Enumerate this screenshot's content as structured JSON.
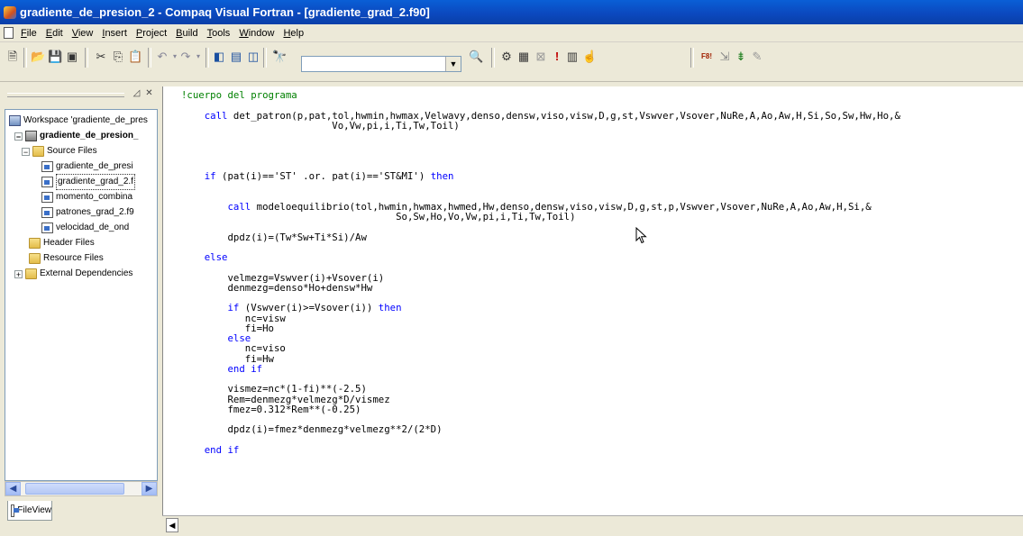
{
  "window": {
    "title": "gradiente_de_presion_2 - Compaq Visual Fortran - [gradiente_grad_2.f90]"
  },
  "menu": {
    "items": [
      {
        "u": "F",
        "rest": "ile"
      },
      {
        "u": "E",
        "rest": "dit"
      },
      {
        "u": "V",
        "rest": "iew"
      },
      {
        "u": "I",
        "rest": "nsert"
      },
      {
        "u": "P",
        "rest": "roject"
      },
      {
        "u": "B",
        "rest": "uild"
      },
      {
        "u": "T",
        "rest": "ools"
      },
      {
        "u": "W",
        "rest": "indow"
      },
      {
        "u": "H",
        "rest": "elp"
      }
    ]
  },
  "toolbar": {
    "find_value": "",
    "icons": [
      "new-file-icon",
      "open-folder-icon",
      "save-icon",
      "save-all-icon",
      "cut-icon",
      "copy-icon",
      "paste-icon",
      "undo-icon",
      "redo-icon",
      "workspace-icon",
      "output-icon",
      "windows-icon",
      "find-in-files-icon",
      "find-icon",
      "compile-icon",
      "build-icon",
      "stop-build-icon",
      "execute-icon",
      "breakpoint-icon",
      "go-icon",
      "f8-icon",
      "step-icon",
      "debug-icon",
      "pen-icon"
    ]
  },
  "workspace": {
    "tree": [
      {
        "label": "Workspace 'gradiente_de_pres",
        "icon": "workspace-icon",
        "expander": ""
      },
      {
        "label": "gradiente_de_presion_",
        "icon": "project-icon",
        "expander": "−",
        "bold": true
      },
      {
        "label": "Source Files",
        "icon": "folder-icon",
        "expander": "−"
      },
      {
        "label": "gradiente_de_presi",
        "icon": "file-icon",
        "expander": ""
      },
      {
        "label": "gradiente_grad_2.f",
        "icon": "file-icon",
        "expander": "",
        "selected": true
      },
      {
        "label": "momento_combina",
        "icon": "file-icon",
        "expander": ""
      },
      {
        "label": "patrones_grad_2.f9",
        "icon": "file-icon",
        "expander": ""
      },
      {
        "label": "velocidad_de_ond",
        "icon": "file-icon",
        "expander": ""
      },
      {
        "label": "Header Files",
        "icon": "folder-icon",
        "expander": ""
      },
      {
        "label": "Resource Files",
        "icon": "folder-icon",
        "expander": ""
      },
      {
        "label": "External Dependencies",
        "icon": "folder-icon",
        "expander": "+"
      }
    ],
    "tab_label": "FileView"
  },
  "editor": {
    "lines": [
      "!cuerpo del programa",
      "",
      "    call det_patron(p,pat,tol,hwmin,hwmax,Velwavy,denso,densw,viso,visw,D,g,st,Vswver,Vsover,NuRe,A,Ao,Aw,H,Si,So,Sw,Hw,Ho,&",
      "                          Vo,Vw,pi,i,Ti,Tw,Toil)",
      "",
      "",
      "",
      "",
      "    if (pat(i)=='ST' .or. pat(i)=='ST&MI') then",
      "",
      "",
      "        call modeloequilibrio(tol,hwmin,hwmax,hwmed,Hw,denso,densw,viso,visw,D,g,st,p,Vswver,Vsover,NuRe,A,Ao,Aw,H,Si,&",
      "                                     So,Sw,Ho,Vo,Vw,pi,i,Ti,Tw,Toil)",
      "",
      "        dpdz(i)=(Tw*Sw+Ti*Si)/Aw",
      "",
      "    else",
      "",
      "        velmezg=Vswver(i)+Vsover(i)",
      "        denmezg=denso*Ho+densw*Hw",
      "",
      "        if (Vswver(i)>=Vsover(i)) then",
      "           nc=visw",
      "           fi=Ho",
      "        else",
      "           nc=viso",
      "           fi=Hw",
      "        end if",
      "",
      "        vismez=nc*(1-fi)**(-2.5)",
      "        Rem=denmezg*velmezg*D/vismez",
      "        fmez=0.312*Rem**(-0.25)",
      "",
      "        dpdz(i)=fmez*denmezg*velmezg**2/(2*D)",
      "",
      "    end if"
    ]
  },
  "colors": {
    "title_bar": "#0b49bf",
    "keyword": "#0000ff",
    "comment": "#008000",
    "chrome": "#ece9d8"
  }
}
